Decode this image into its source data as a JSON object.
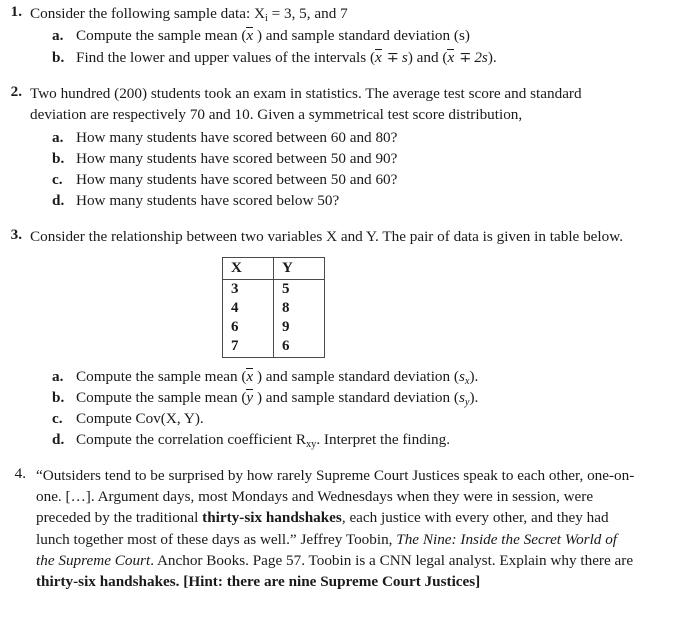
{
  "document": {
    "type": "statistics-worksheet"
  },
  "questions": [
    {
      "number": "1.",
      "bold_number": true,
      "text_pre": "Consider the following sample data: X",
      "text_sub": "i",
      "text_post": " = 3, 5, and 7",
      "subitems": [
        {
          "letter": "a.",
          "pre": "Compute the sample mean (",
          "sym": "x",
          "post": " ) and sample standard deviation (s)"
        },
        {
          "letter": "b.",
          "pre": "Find the lower and upper values of the intervals (",
          "sym1": "x",
          "op1": "∓",
          "mid1": "s",
          "mid2": ") and (",
          "sym2": "x",
          "op2": "∓",
          "mid3": "2s",
          "post": ")."
        }
      ]
    },
    {
      "number": "2.",
      "bold_number": true,
      "text": "Two hundred (200) students took an exam in statistics. The average test score and standard deviation are respectively 70 and 10. Given a symmetrical test score distribution,",
      "subitems": [
        {
          "letter": "a.",
          "text": "How many students have scored between 60 and 80?"
        },
        {
          "letter": "b.",
          "text": "How many students have scored between 50 and 90?"
        },
        {
          "letter": "c.",
          "text": "How many students have scored between 50 and 60?"
        },
        {
          "letter": "d.",
          "text": "How many students have scored below 50?"
        }
      ]
    },
    {
      "number": "3.",
      "bold_number": true,
      "text": "Consider the relationship between two variables X and Y. The pair of data is given in table below.",
      "table": {
        "headers": [
          "X",
          "Y"
        ],
        "rows": [
          [
            "3",
            "5"
          ],
          [
            "4",
            "8"
          ],
          [
            "6",
            "9"
          ],
          [
            "7",
            "6"
          ]
        ]
      },
      "subitems": [
        {
          "letter": "a.",
          "pre": "Compute the sample mean (",
          "sym": "x",
          "mid": " ) and sample standard deviation (",
          "s": "s",
          "ssub": "x",
          "post": ")."
        },
        {
          "letter": "b.",
          "pre": "Compute the sample mean (",
          "sym": "y",
          "mid": " ) and sample standard deviation (",
          "s": "s",
          "ssub": "y",
          "post": ")."
        },
        {
          "letter": "c.",
          "text": "Compute Cov(X, Y)."
        },
        {
          "letter": "d.",
          "pre": "Compute the correlation coefficient R",
          "rsub": "xy",
          "post": ". Interpret the finding."
        }
      ]
    },
    {
      "number": "4.",
      "bold_number": false,
      "parts": {
        "p1": "“Outsiders tend to be surprised by how rarely Supreme Court Justices speak to each other, one-on-one. […]. Argument days, most Mondays and Wednesdays when they were in session, were preceded by the traditional ",
        "b1": "thirty-six handshakes",
        "p2": ", each justice with every other, and they had lunch together most of these days as well.” Jeffrey Toobin, ",
        "i1": "The Nine: Inside the Secret World of the Supreme Court",
        "p3": ". Anchor Books. Page 57. Toobin is a CNN legal analyst. Explain why there are ",
        "b2": "thirty-six handshakes. [Hint: there are nine Supreme Court Justices]"
      }
    }
  ]
}
